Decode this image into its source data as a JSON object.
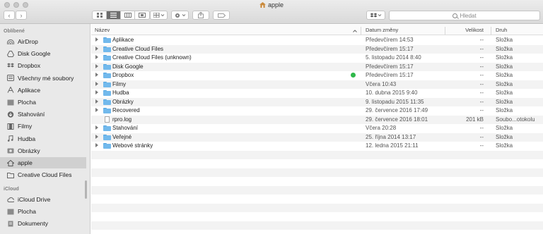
{
  "window": {
    "title": "apple"
  },
  "toolbar": {
    "search_placeholder": "Hledat"
  },
  "sidebar": {
    "favorites_header": "Oblíbené",
    "favorites": [
      {
        "label": "AirDrop",
        "icon": "airdrop-icon"
      },
      {
        "label": "Disk Google",
        "icon": "google-drive-icon"
      },
      {
        "label": "Dropbox",
        "icon": "dropbox-icon"
      },
      {
        "label": "Všechny mé soubory",
        "icon": "all-files-icon"
      },
      {
        "label": "Aplikace",
        "icon": "applications-icon"
      },
      {
        "label": "Plocha",
        "icon": "desktop-icon"
      },
      {
        "label": "Stahování",
        "icon": "downloads-icon"
      },
      {
        "label": "Filmy",
        "icon": "movies-icon"
      },
      {
        "label": "Hudba",
        "icon": "music-icon"
      },
      {
        "label": "Obrázky",
        "icon": "pictures-icon"
      },
      {
        "label": "apple",
        "icon": "home-icon"
      },
      {
        "label": "Creative Cloud Files",
        "icon": "folder-icon"
      }
    ],
    "icloud_header": "iCloud",
    "icloud": [
      {
        "label": "iCloud Drive",
        "icon": "cloud-icon"
      },
      {
        "label": "Plocha",
        "icon": "desktop-icon"
      },
      {
        "label": "Dokumenty",
        "icon": "documents-icon"
      }
    ]
  },
  "columns": {
    "name": "Název",
    "date": "Datum změny",
    "size": "Velikost",
    "kind": "Druh"
  },
  "files": [
    {
      "name": "Aplikace",
      "date": "Předevčírem 14:53",
      "size": "--",
      "kind": "Složka"
    },
    {
      "name": "Creative Cloud Files",
      "date": "Předevčírem 15:17",
      "size": "--",
      "kind": "Složka"
    },
    {
      "name": "Creative Cloud Files (unknown)",
      "date": "5. listopadu 2014 8:40",
      "size": "--",
      "kind": "Složka"
    },
    {
      "name": "Disk Google",
      "date": "Předevčírem 15:17",
      "size": "--",
      "kind": "Složka"
    },
    {
      "name": "Dropbox",
      "date": "Předevčírem 15:17",
      "size": "--",
      "kind": "Složka"
    },
    {
      "name": "Filmy",
      "date": "Včera 10:43",
      "size": "--",
      "kind": "Složka"
    },
    {
      "name": "Hudba",
      "date": "10. dubna 2015 9:40",
      "size": "--",
      "kind": "Složka"
    },
    {
      "name": "Obrázky",
      "date": "9. listopadu 2015 11:35",
      "size": "--",
      "kind": "Složka"
    },
    {
      "name": "Recovered",
      "date": "29. července 2016 17:49",
      "size": "--",
      "kind": "Složka"
    },
    {
      "name": "rpro.log",
      "date": "29. července 2016 18:01",
      "size": "201 kB",
      "kind": "Soubo...otokolu"
    },
    {
      "name": "Stahování",
      "date": "Včera 20:28",
      "size": "--",
      "kind": "Složka"
    },
    {
      "name": "Veřejné",
      "date": "25. října 2014 13:17",
      "size": "--",
      "kind": "Složka"
    },
    {
      "name": "Webové stránky",
      "date": "12. ledna 2015 21:11",
      "size": "--",
      "kind": "Složka"
    }
  ]
}
